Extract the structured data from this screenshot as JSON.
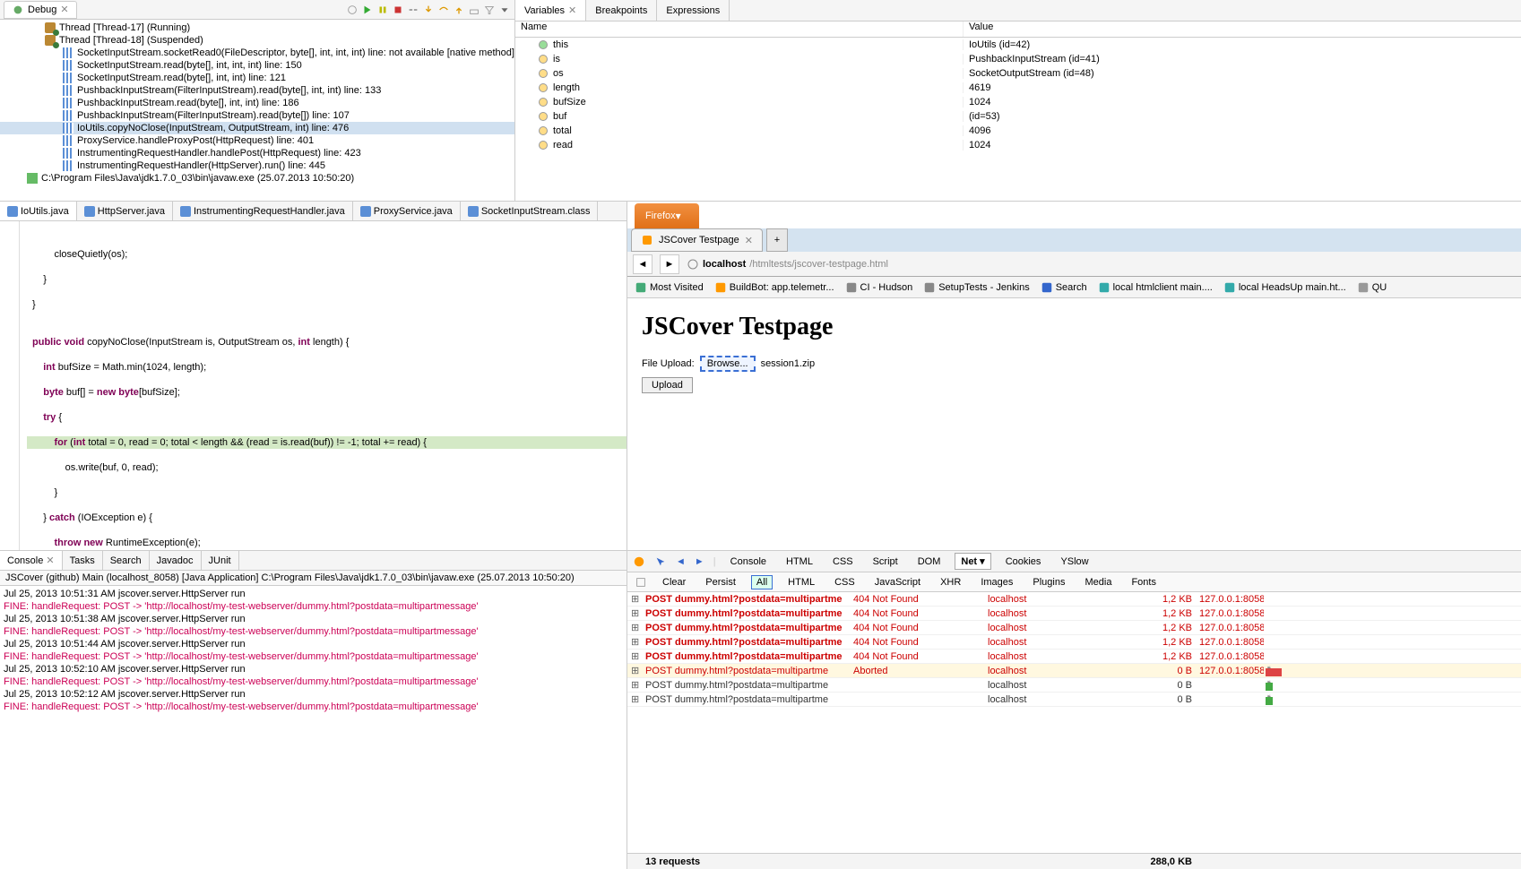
{
  "debug": {
    "tabLabel": "Debug",
    "threads": [
      {
        "label": "Thread [Thread-17] (Running)"
      },
      {
        "label": "Thread [Thread-18] (Suspended)"
      }
    ],
    "stack": [
      "SocketInputStream.socketRead0(FileDescriptor, byte[], int, int, int) line: not available [native method]",
      "SocketInputStream.read(byte[], int, int, int) line: 150",
      "SocketInputStream.read(byte[], int, int) line: 121",
      "PushbackInputStream(FilterInputStream).read(byte[], int, int) line: 133",
      "PushbackInputStream.read(byte[], int, int) line: 186",
      "PushbackInputStream(FilterInputStream).read(byte[]) line: 107",
      "IoUtils.copyNoClose(InputStream, OutputStream, int) line: 476",
      "ProxyService.handleProxyPost(HttpRequest) line: 401",
      "InstrumentingRequestHandler.handlePost(HttpRequest) line: 423",
      "InstrumentingRequestHandler(HttpServer).run() line: 445"
    ],
    "process": "C:\\Program Files\\Java\\jdk1.7.0_03\\bin\\javaw.exe (25.07.2013 10:50:20)"
  },
  "vars": {
    "tabs": [
      "Variables",
      "Breakpoints",
      "Expressions"
    ],
    "cols": [
      "Name",
      "Value"
    ],
    "rows": [
      {
        "name": "this",
        "value": "IoUtils  (id=42)",
        "icon": "green"
      },
      {
        "name": "is",
        "value": "PushbackInputStream  (id=41)",
        "icon": "yellow"
      },
      {
        "name": "os",
        "value": "SocketOutputStream  (id=48)",
        "icon": "yellow"
      },
      {
        "name": "length",
        "value": "4619",
        "icon": "yellow"
      },
      {
        "name": "bufSize",
        "value": "1024",
        "icon": "yellow"
      },
      {
        "name": "buf",
        "value": "(id=53)",
        "icon": "yellow"
      },
      {
        "name": "total",
        "value": "4096",
        "icon": "yellow"
      },
      {
        "name": "read",
        "value": "1024",
        "icon": "yellow"
      }
    ]
  },
  "editor": {
    "tabs": [
      "IoUtils.java",
      "HttpServer.java",
      "InstrumentingRequestHandler.java",
      "ProxyService.java",
      "SocketInputStream.class"
    ],
    "activeTab": 0
  },
  "firefox": {
    "title": "Firefox",
    "tabTitle": "JSCover Testpage",
    "urlHost": "localhost",
    "urlPath": "/htmltests/jscover-testpage.html",
    "bookmarks": [
      "Most Visited",
      "BuildBot: app.telemetr...",
      "CI - Hudson",
      "SetupTests - Jenkins",
      "Search",
      "local htmlclient main....",
      "local HeadsUp main.ht...",
      "QU"
    ],
    "pageTitle": "JSCover Testpage",
    "fileUploadLabel": "File Upload:",
    "browseLabel": "Browse...",
    "fileName": "session1.zip",
    "uploadLabel": "Upload"
  },
  "console": {
    "tabs": [
      "Console",
      "Tasks",
      "Search",
      "Javadoc",
      "JUnit"
    ],
    "info": "JSCover (github) Main (localhost_8058) [Java Application] C:\\Program Files\\Java\\jdk1.7.0_03\\bin\\javaw.exe (25.07.2013 10:50:20)",
    "lines": [
      {
        "t": "n",
        "text": "Jul 25, 2013 10:51:31 AM jscover.server.HttpServer run"
      },
      {
        "t": "f",
        "text": "FINE: handleRequest: POST -> 'http://localhost/my-test-webserver/dummy.html?postdata=multipartmessage'"
      },
      {
        "t": "n",
        "text": "Jul 25, 2013 10:51:38 AM jscover.server.HttpServer run"
      },
      {
        "t": "f",
        "text": "FINE: handleRequest: POST -> 'http://localhost/my-test-webserver/dummy.html?postdata=multipartmessage'"
      },
      {
        "t": "n",
        "text": "Jul 25, 2013 10:51:44 AM jscover.server.HttpServer run"
      },
      {
        "t": "f",
        "text": "FINE: handleRequest: POST -> 'http://localhost/my-test-webserver/dummy.html?postdata=multipartmessage'"
      },
      {
        "t": "n",
        "text": "Jul 25, 2013 10:52:10 AM jscover.server.HttpServer run"
      },
      {
        "t": "f",
        "text": "FINE: handleRequest: POST -> 'http://localhost/my-test-webserver/dummy.html?postdata=multipartmessage'"
      },
      {
        "t": "n",
        "text": "Jul 25, 2013 10:52:12 AM jscover.server.HttpServer run"
      },
      {
        "t": "f",
        "text": "FINE: handleRequest: POST -> 'http://localhost/my-test-webserver/dummy.html?postdata=multipartmessage'"
      }
    ]
  },
  "firebug": {
    "mainTabs": [
      "Console",
      "HTML",
      "CSS",
      "Script",
      "DOM",
      "Net",
      "Cookies",
      "YSlow"
    ],
    "filterBtns": [
      "Clear",
      "Persist"
    ],
    "filters": [
      "All",
      "HTML",
      "CSS",
      "JavaScript",
      "XHR",
      "Images",
      "Plugins",
      "Media",
      "Fonts"
    ],
    "rows": [
      {
        "type": "err",
        "url": "POST dummy.html?postdata=multipartme",
        "status": "404 Not Found",
        "domain": "localhost",
        "size": "1,2 KB",
        "ip": "127.0.0.1:8058"
      },
      {
        "type": "err",
        "url": "POST dummy.html?postdata=multipartme",
        "status": "404 Not Found",
        "domain": "localhost",
        "size": "1,2 KB",
        "ip": "127.0.0.1:8058"
      },
      {
        "type": "err",
        "url": "POST dummy.html?postdata=multipartme",
        "status": "404 Not Found",
        "domain": "localhost",
        "size": "1,2 KB",
        "ip": "127.0.0.1:8058"
      },
      {
        "type": "err",
        "url": "POST dummy.html?postdata=multipartme",
        "status": "404 Not Found",
        "domain": "localhost",
        "size": "1,2 KB",
        "ip": "127.0.0.1:8058"
      },
      {
        "type": "err",
        "url": "POST dummy.html?postdata=multipartme",
        "status": "404 Not Found",
        "domain": "localhost",
        "size": "1,2 KB",
        "ip": "127.0.0.1:8058"
      },
      {
        "type": "aborted",
        "url": "POST dummy.html?postdata=multipartme",
        "status": "Aborted",
        "domain": "localhost",
        "size": "0 B",
        "ip": "127.0.0.1:8058"
      },
      {
        "type": "pending",
        "url": "POST dummy.html?postdata=multipartme",
        "status": "",
        "domain": "localhost",
        "size": "0 B",
        "ip": ""
      },
      {
        "type": "pending",
        "url": "POST dummy.html?postdata=multipartme",
        "status": "",
        "domain": "localhost",
        "size": "0 B",
        "ip": ""
      }
    ],
    "summary": {
      "count": "13 requests",
      "size": "288,0 KB"
    }
  }
}
